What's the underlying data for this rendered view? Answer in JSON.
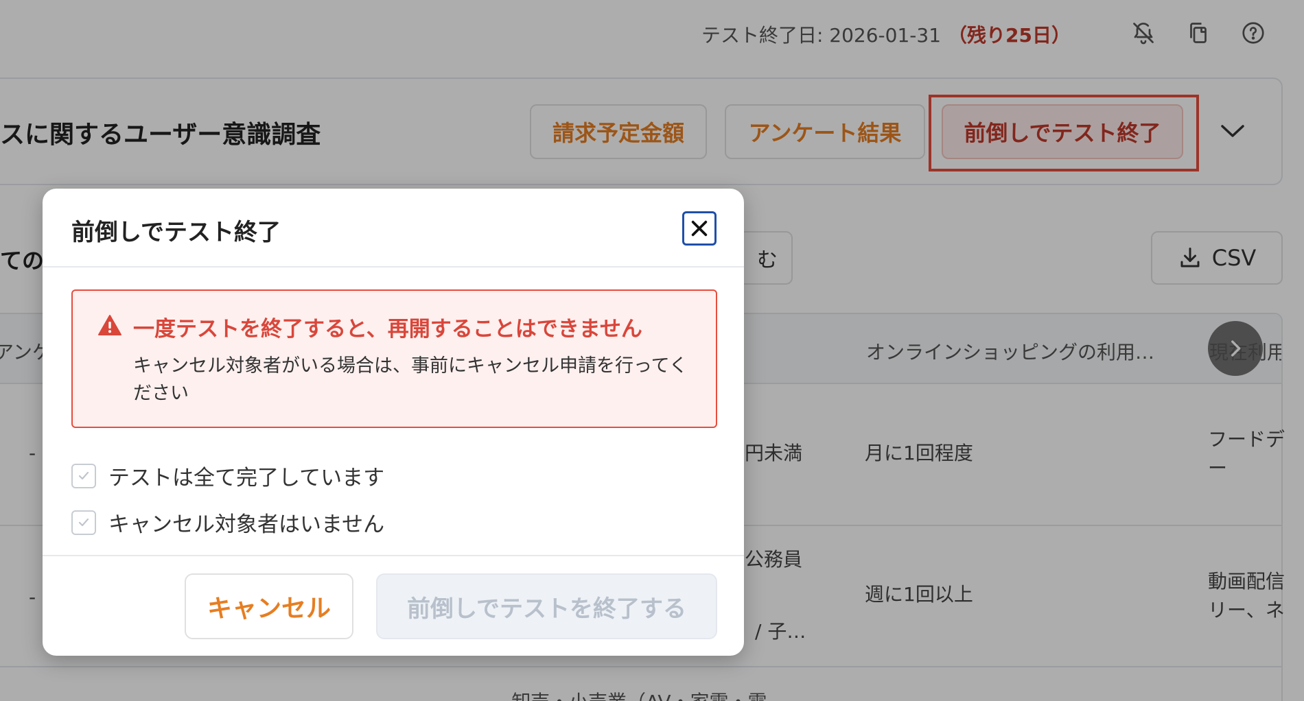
{
  "topbar": {
    "deadline_label": "テスト終了日: 2026-01-31",
    "remaining": "（残り25日）",
    "icons": [
      "bell-off-icon",
      "copy-icon",
      "help-icon"
    ]
  },
  "header": {
    "title": "スに関するユーザー意識調査",
    "buttons": {
      "billing": "請求予定金額",
      "results": "アンケート結果",
      "end_early": "前倒しでテスト終了"
    }
  },
  "filters": {
    "left_text": "ての",
    "filter_button_fragment": "む",
    "csv_label": "CSV"
  },
  "table": {
    "headers": {
      "col1": "アンケ",
      "col_shopping": "オンラインショッピングの利用…",
      "col_current": "現在利用"
    },
    "rows": [
      {
        "c1": "-",
        "c_income": "円未満",
        "c_shopping": "月に1回程度",
        "c_current": "フードデ\nー"
      },
      {
        "c1": "-",
        "c_job": "公務員",
        "c_family": "/ 子…",
        "c_shopping": "週に1回以上",
        "c_current": "動画配信\nリー、ネ"
      }
    ],
    "bottom_text": "卸売・小売業（AV・家電・電…"
  },
  "modal": {
    "title": "前倒しでテスト終了",
    "alert_title": "一度テストを終了すると、再開することはできません",
    "alert_body": "キャンセル対象者がいる場合は、事前にキャンセル申請を行ってください",
    "checks": [
      {
        "label": "テストは全て完了しています",
        "checked": true
      },
      {
        "label": "キャンセル対象者はいません",
        "checked": true
      }
    ],
    "cancel_label": "キャンセル",
    "confirm_label": "前倒しでテストを終了する"
  },
  "colors": {
    "accent_orange": "#e67e22",
    "danger_red": "#d9463a",
    "focus_blue": "#1f4fa8"
  }
}
